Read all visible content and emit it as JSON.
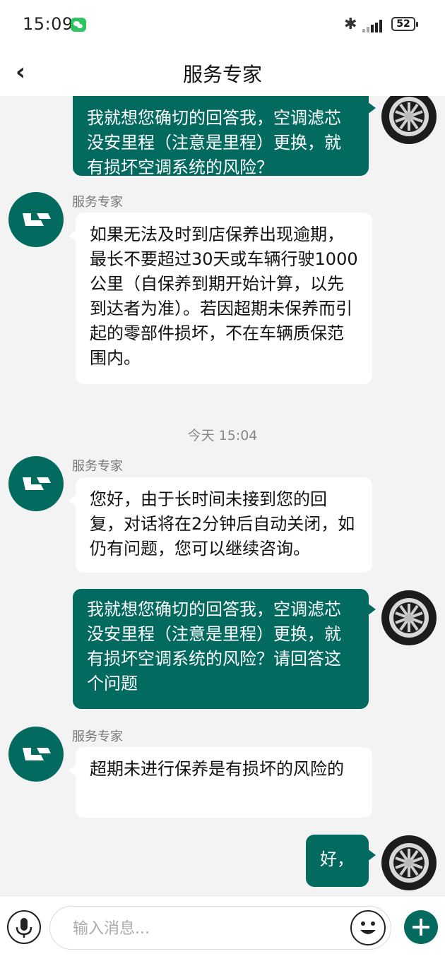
{
  "status_bar": {
    "time": "15:09",
    "battery": "52"
  },
  "header": {
    "back_icon": "‹",
    "title": "服务专家"
  },
  "colors": {
    "accent": "#036a60",
    "agent_bubble": "#ffffff",
    "background": "#f3f3f3"
  },
  "messages": [
    {
      "from": "user",
      "text": "我就想您确切的回答我，空调滤芯没安里程（注意是里程）更换，就有损坏空调系统的风险？"
    },
    {
      "from": "agent",
      "sender": "服务专家",
      "text": "如果无法及时到店保养出现逾期，最长不要超过30天或车辆行驶1000公里（自保养到期开始计算，以先到达者为准）。若因超期未保养而引起的零部件损坏，不在车辆质保范围内。"
    },
    {
      "from": "system",
      "text": "今天 15:04"
    },
    {
      "from": "agent",
      "sender": "服务专家",
      "text": "您好，由于长时间未接到您的回复，对话将在2分钟后自动关闭，如仍有问题，您可以继续咨询。"
    },
    {
      "from": "user",
      "text": "我就想您确切的回答我，空调滤芯没安里程（注意是里程）更换，就有损坏空调系统的风险？请回答这个问题"
    },
    {
      "from": "agent",
      "sender": "服务专家",
      "text": "超期未进行保养是有损坏的风险的"
    },
    {
      "from": "user",
      "text": "好，"
    }
  ],
  "input_bar": {
    "placeholder": "输入消息...",
    "icons": [
      "microphone-icon",
      "emoji-icon",
      "plus-icon"
    ]
  }
}
